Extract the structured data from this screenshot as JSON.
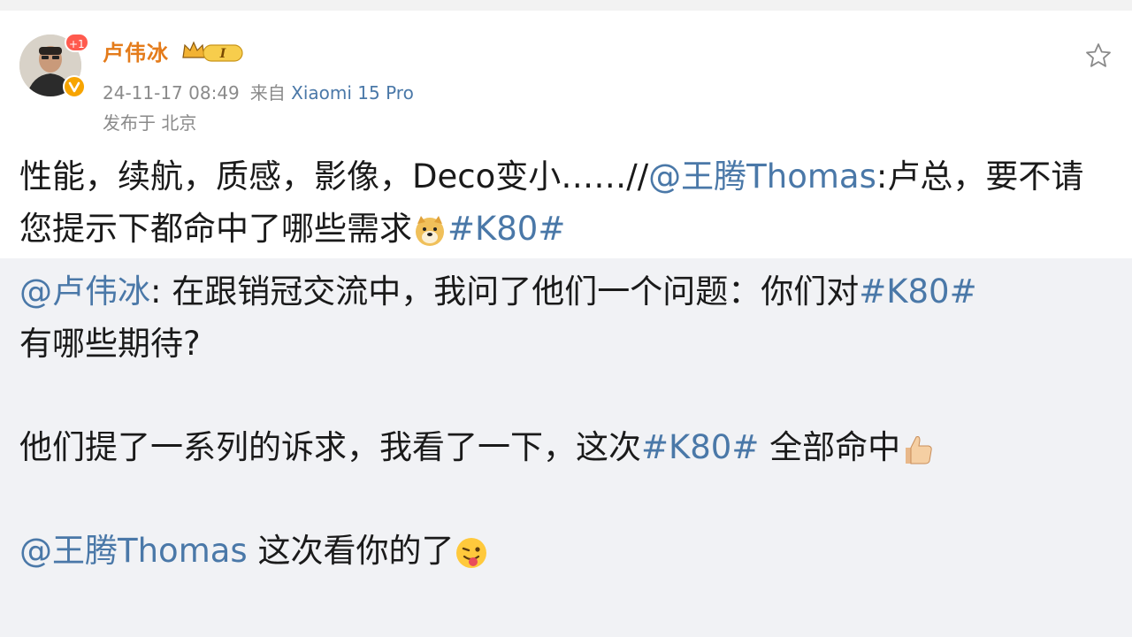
{
  "post": {
    "author": {
      "name": "卢伟冰",
      "avatar_badge": "+1",
      "vip_badge_text": "I"
    },
    "time": "24-11-17 08:49",
    "source_prefix": "来自",
    "source": "Xiaomi 15 Pro",
    "location": "发布于 北京",
    "text": {
      "part1": "性能，续航，质感，影像，Deco变小……//",
      "mention": "@王腾Thomas",
      "part2": ":卢总，要不请您提示下都命中了哪些需求",
      "hashtag": "#K80#"
    }
  },
  "retweet": {
    "author_mention": "@卢伟冰",
    "line1_rest": ": 在跟销冠交流中，我问了他们一个问题：你们对",
    "line1_hashtag": "#K80#",
    "line2": "有哪些期待?",
    "para2_start": "他们提了一系列的诉求，我看了一下，这次",
    "para2_hashtag": "#K80#",
    "para2_end": " 全部命中",
    "para3_mention": "@王腾Thomas",
    "para3_text": " 这次看你的了"
  },
  "icons": {
    "favorite": "star-outline-icon",
    "doge": "doge-emoji",
    "thumbs": "thumbs-up-emoji",
    "tongue": "tongue-out-emoji"
  },
  "colors": {
    "username": "#e47b1a",
    "link": "#4a78a8",
    "meta": "#8a8a8a",
    "retweet_bg": "#f1f2f5"
  }
}
